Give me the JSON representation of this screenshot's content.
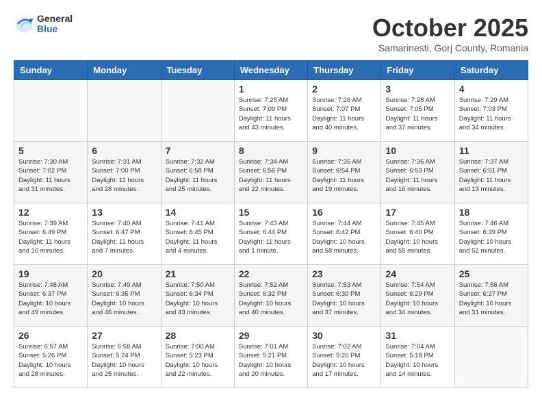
{
  "logo": {
    "general": "General",
    "blue": "Blue"
  },
  "title": "October 2025",
  "subtitle": "Samarinesti, Gorj County, Romania",
  "days_of_week": [
    "Sunday",
    "Monday",
    "Tuesday",
    "Wednesday",
    "Thursday",
    "Friday",
    "Saturday"
  ],
  "weeks": [
    [
      {
        "day": "",
        "info": ""
      },
      {
        "day": "",
        "info": ""
      },
      {
        "day": "",
        "info": ""
      },
      {
        "day": "1",
        "info": "Sunrise: 7:25 AM\nSunset: 7:09 PM\nDaylight: 11 hours\nand 43 minutes."
      },
      {
        "day": "2",
        "info": "Sunrise: 7:26 AM\nSunset: 7:07 PM\nDaylight: 11 hours\nand 40 minutes."
      },
      {
        "day": "3",
        "info": "Sunrise: 7:28 AM\nSunset: 7:05 PM\nDaylight: 11 hours\nand 37 minutes."
      },
      {
        "day": "4",
        "info": "Sunrise: 7:29 AM\nSunset: 7:03 PM\nDaylight: 11 hours\nand 34 minutes."
      }
    ],
    [
      {
        "day": "5",
        "info": "Sunrise: 7:30 AM\nSunset: 7:02 PM\nDaylight: 11 hours\nand 31 minutes."
      },
      {
        "day": "6",
        "info": "Sunrise: 7:31 AM\nSunset: 7:00 PM\nDaylight: 11 hours\nand 28 minutes."
      },
      {
        "day": "7",
        "info": "Sunrise: 7:32 AM\nSunset: 6:58 PM\nDaylight: 11 hours\nand 25 minutes."
      },
      {
        "day": "8",
        "info": "Sunrise: 7:34 AM\nSunset: 6:56 PM\nDaylight: 11 hours\nand 22 minutes."
      },
      {
        "day": "9",
        "info": "Sunrise: 7:35 AM\nSunset: 6:54 PM\nDaylight: 11 hours\nand 19 minutes."
      },
      {
        "day": "10",
        "info": "Sunrise: 7:36 AM\nSunset: 6:53 PM\nDaylight: 11 hours\nand 16 minutes."
      },
      {
        "day": "11",
        "info": "Sunrise: 7:37 AM\nSunset: 6:51 PM\nDaylight: 11 hours\nand 13 minutes."
      }
    ],
    [
      {
        "day": "12",
        "info": "Sunrise: 7:39 AM\nSunset: 6:49 PM\nDaylight: 11 hours\nand 10 minutes."
      },
      {
        "day": "13",
        "info": "Sunrise: 7:40 AM\nSunset: 6:47 PM\nDaylight: 11 hours\nand 7 minutes."
      },
      {
        "day": "14",
        "info": "Sunrise: 7:41 AM\nSunset: 6:45 PM\nDaylight: 11 hours\nand 4 minutes."
      },
      {
        "day": "15",
        "info": "Sunrise: 7:43 AM\nSunset: 6:44 PM\nDaylight: 11 hours\nand 1 minute."
      },
      {
        "day": "16",
        "info": "Sunrise: 7:44 AM\nSunset: 6:42 PM\nDaylight: 10 hours\nand 58 minutes."
      },
      {
        "day": "17",
        "info": "Sunrise: 7:45 AM\nSunset: 6:40 PM\nDaylight: 10 hours\nand 55 minutes."
      },
      {
        "day": "18",
        "info": "Sunrise: 7:46 AM\nSunset: 6:39 PM\nDaylight: 10 hours\nand 52 minutes."
      }
    ],
    [
      {
        "day": "19",
        "info": "Sunrise: 7:48 AM\nSunset: 6:37 PM\nDaylight: 10 hours\nand 49 minutes."
      },
      {
        "day": "20",
        "info": "Sunrise: 7:49 AM\nSunset: 6:35 PM\nDaylight: 10 hours\nand 46 minutes."
      },
      {
        "day": "21",
        "info": "Sunrise: 7:50 AM\nSunset: 6:34 PM\nDaylight: 10 hours\nand 43 minutes."
      },
      {
        "day": "22",
        "info": "Sunrise: 7:52 AM\nSunset: 6:32 PM\nDaylight: 10 hours\nand 40 minutes."
      },
      {
        "day": "23",
        "info": "Sunrise: 7:53 AM\nSunset: 6:30 PM\nDaylight: 10 hours\nand 37 minutes."
      },
      {
        "day": "24",
        "info": "Sunrise: 7:54 AM\nSunset: 6:29 PM\nDaylight: 10 hours\nand 34 minutes."
      },
      {
        "day": "25",
        "info": "Sunrise: 7:56 AM\nSunset: 6:27 PM\nDaylight: 10 hours\nand 31 minutes."
      }
    ],
    [
      {
        "day": "26",
        "info": "Sunrise: 6:57 AM\nSunset: 5:26 PM\nDaylight: 10 hours\nand 28 minutes."
      },
      {
        "day": "27",
        "info": "Sunrise: 6:58 AM\nSunset: 5:24 PM\nDaylight: 10 hours\nand 25 minutes."
      },
      {
        "day": "28",
        "info": "Sunrise: 7:00 AM\nSunset: 5:23 PM\nDaylight: 10 hours\nand 22 minutes."
      },
      {
        "day": "29",
        "info": "Sunrise: 7:01 AM\nSunset: 5:21 PM\nDaylight: 10 hours\nand 20 minutes."
      },
      {
        "day": "30",
        "info": "Sunrise: 7:02 AM\nSunset: 5:20 PM\nDaylight: 10 hours\nand 17 minutes."
      },
      {
        "day": "31",
        "info": "Sunrise: 7:04 AM\nSunset: 5:18 PM\nDaylight: 10 hours\nand 14 minutes."
      },
      {
        "day": "",
        "info": ""
      }
    ]
  ]
}
